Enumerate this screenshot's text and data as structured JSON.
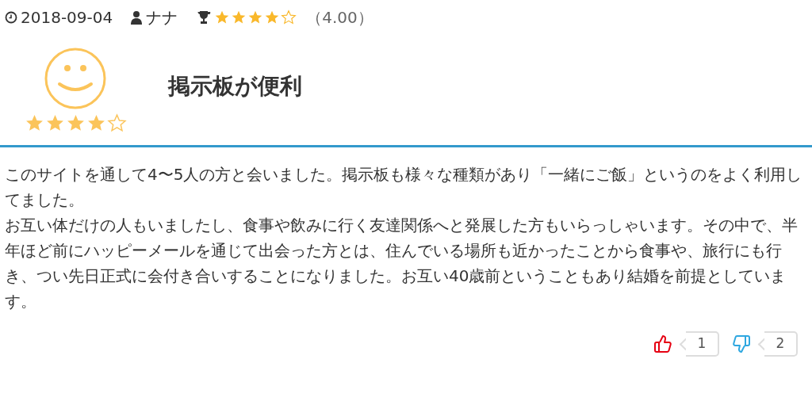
{
  "meta": {
    "date": "2018-09-04",
    "author": "ナナ",
    "stars": 4,
    "score": "（4.00）"
  },
  "review": {
    "stars": 4,
    "title": "掲示板が便利"
  },
  "body": [
    "このサイトを通して4〜5人の方と会いました。掲示板も様々な種類があり「一緒にご飯」というのをよく利用してました。",
    "お互い体だけの人もいましたし、食事や飲みに行く友達関係へと発展した方もいらっしゃいます。その中で、半年ほど前にハッピーメールを通じて出会った方とは、住んでいる場所も近かったことから食事や、旅行にも行き、つい先日正式に会付き合いすることになりました。お互い40歳前ということもあり結婚を前提としています。"
  ],
  "votes": [
    {
      "kind": "up",
      "count": "1"
    },
    {
      "kind": "down",
      "count": "2"
    }
  ]
}
